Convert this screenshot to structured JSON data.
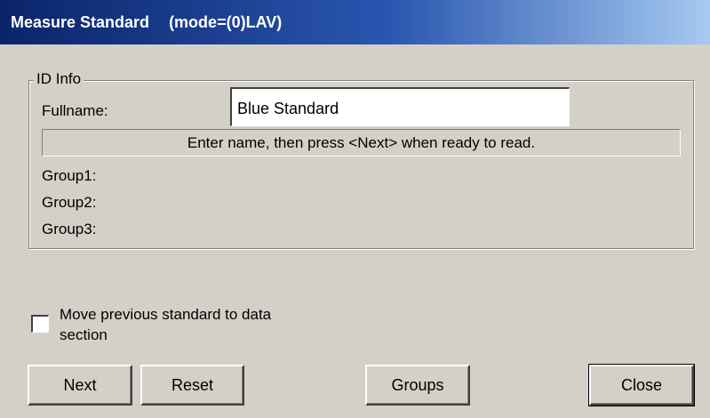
{
  "window": {
    "title": "Measure Standard",
    "mode": "(mode=(0)LAV)"
  },
  "id_info": {
    "legend": "ID Info",
    "fullname_label": "Fullname:",
    "fullname_value": "Blue Standard",
    "status_message": "Enter name, then press <Next> when ready to read.",
    "group_labels": [
      "Group1:",
      "Group2:",
      "Group3:"
    ]
  },
  "options": {
    "move_previous_label": "Move previous standard to data section",
    "move_previous_checked": false
  },
  "buttons": {
    "next": "Next",
    "reset": "Reset",
    "groups": "Groups",
    "close": "Close"
  },
  "colors": {
    "title_gradient_start": "#0a246a",
    "title_gradient_end": "#a6caf0",
    "dialog_face": "#d4d0c8"
  }
}
